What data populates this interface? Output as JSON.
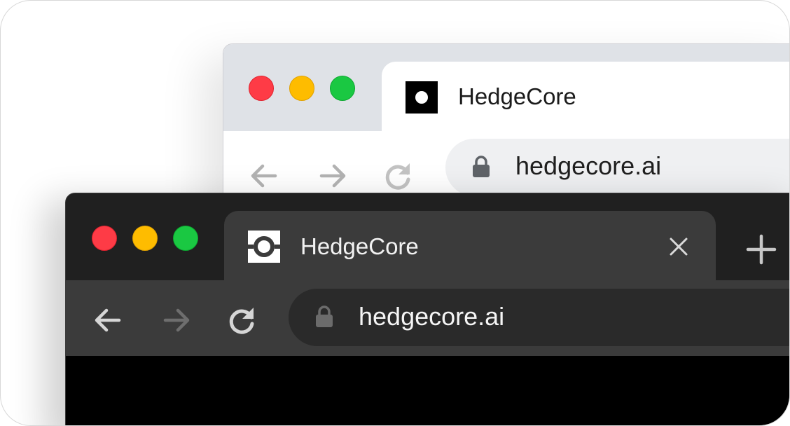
{
  "light_browser": {
    "tab": {
      "title": "HedgeCore",
      "favicon": "hedgecore-logo-icon"
    },
    "toolbar": {
      "back_icon": "arrow-left-icon",
      "forward_icon": "arrow-right-icon",
      "reload_icon": "reload-icon"
    },
    "omnibox": {
      "url": "hedgecore.ai",
      "lock_icon": "lock-icon"
    },
    "colors": {
      "tabstrip": "#dfe2e7",
      "tab": "#ffffff",
      "omnibox": "#eff0f2",
      "text": "#1b1b1b"
    }
  },
  "dark_browser": {
    "tab": {
      "title": "HedgeCore",
      "favicon": "hedgecore-logo-icon",
      "close_icon": "close-icon"
    },
    "new_tab_icon": "plus-icon",
    "toolbar": {
      "back_icon": "arrow-left-icon",
      "forward_icon": "arrow-right-icon",
      "reload_icon": "reload-icon"
    },
    "omnibox": {
      "url": "hedgecore.ai",
      "lock_icon": "lock-icon"
    },
    "colors": {
      "tabstrip": "#202020",
      "tab": "#3b3b3b",
      "omnibox": "#2a2a2a",
      "content": "#000000",
      "text": "#f2f2f2"
    }
  },
  "traffic_lights": {
    "close": "#fe3b46",
    "minimize": "#febc00",
    "maximize": "#1ac842"
  }
}
